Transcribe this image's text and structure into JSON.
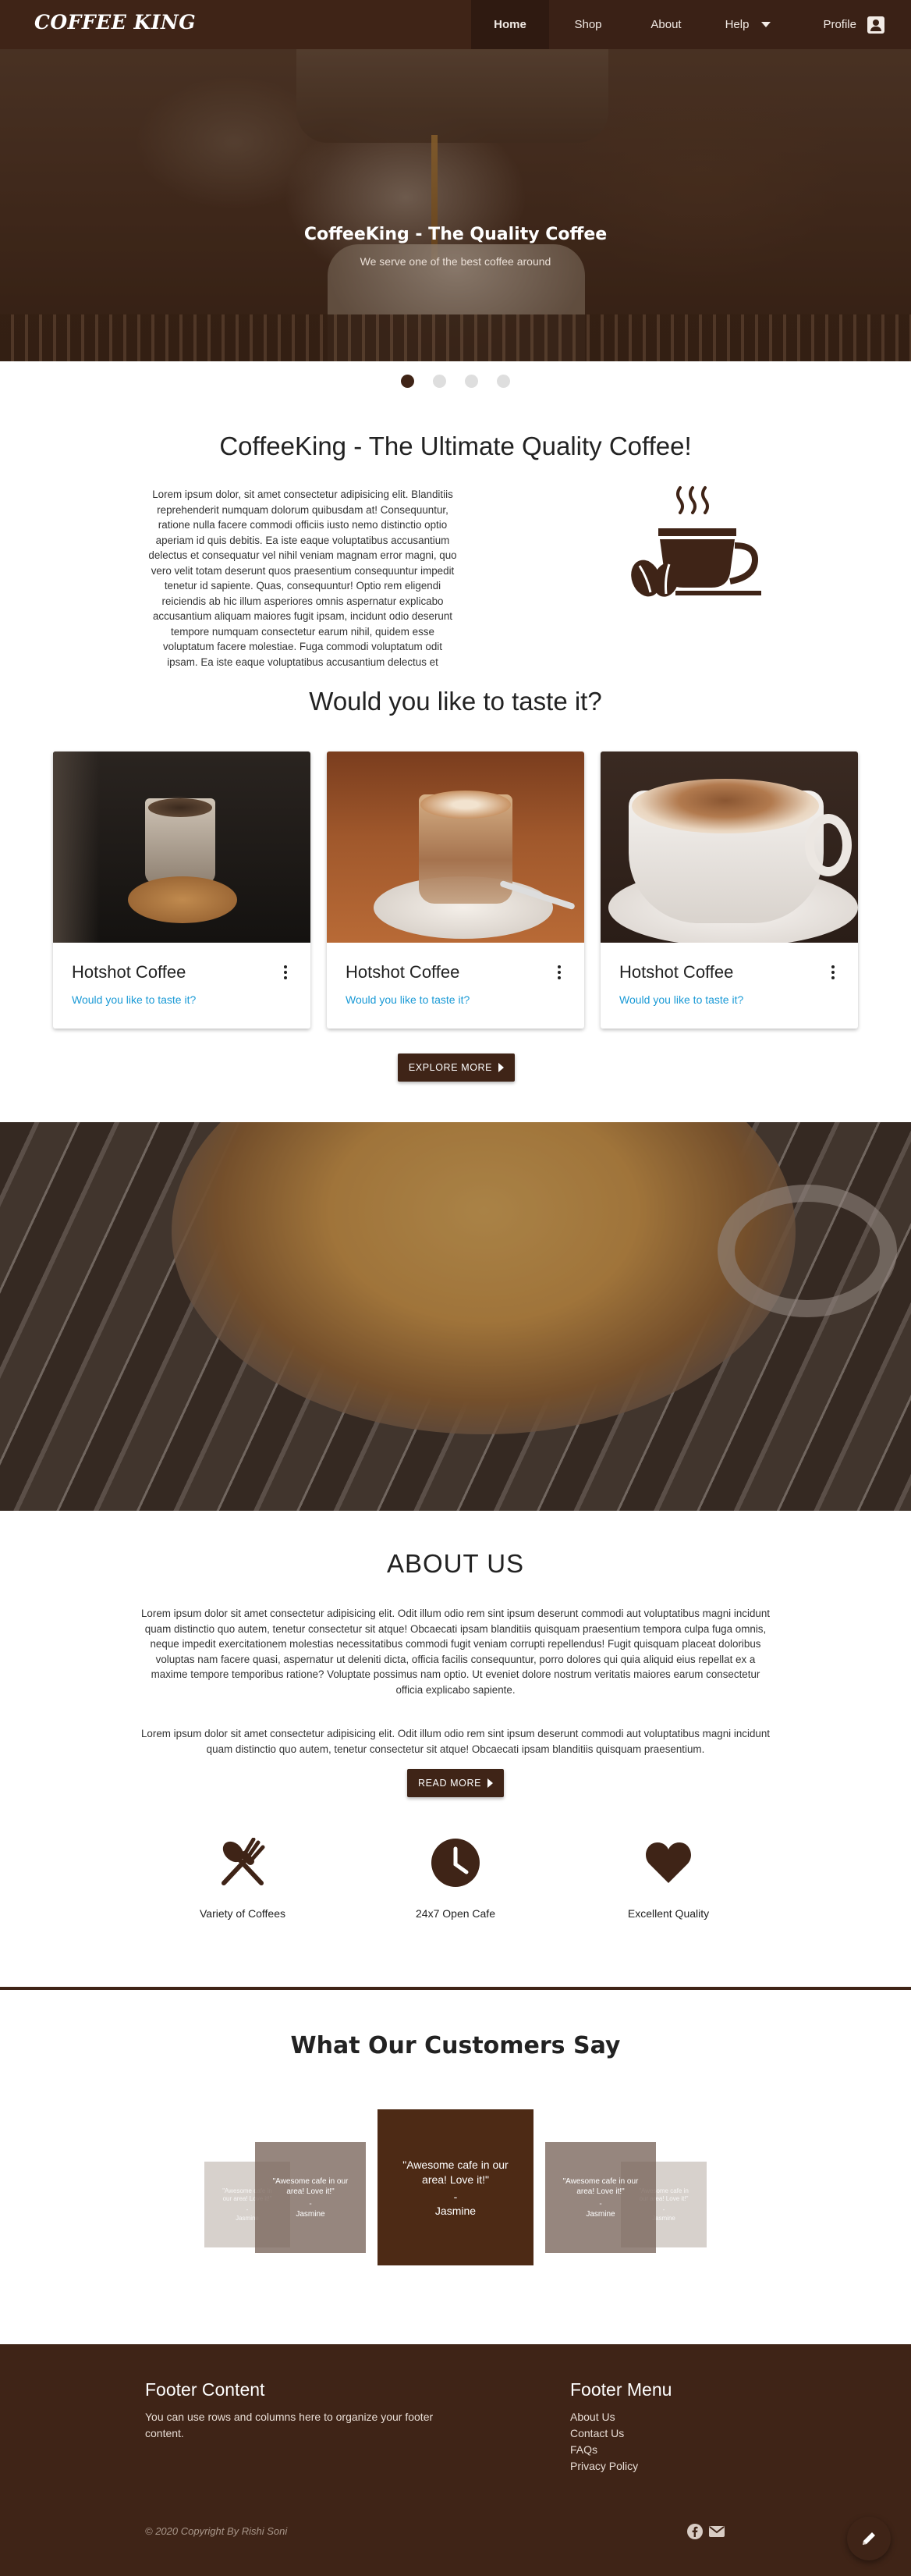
{
  "brand": "COFFEE KING",
  "nav": {
    "items": [
      "Home",
      "Shop",
      "About",
      "Help"
    ],
    "profile": "Profile"
  },
  "hero": {
    "title": "CoffeeKing - The Quality Coffee",
    "subtitle": "We serve one of the best coffee around"
  },
  "carousel": {
    "slides": 4,
    "active": 1
  },
  "intro": {
    "title": "CoffeeKing - The Ultimate Quality Coffee!",
    "text": "Lorem ipsum dolor, sit amet consectetur adipisicing elit. Blanditiis reprehenderit numquam dolorum quibusdam at! Consequuntur, ratione nulla facere commodi officiis iusto nemo distinctio optio aperiam id quis debitis. Ea iste eaque voluptatibus accusantium delectus et consequatur vel nihil veniam magnam error magni, quo vero velit totam deserunt quos praesentium consequuntur impedit tenetur id sapiente. Quas, consequuntur! Optio rem eligendi reiciendis ab hic illum asperiores omnis aspernatur explicabo accusantium aliquam maiores fugit ipsam, incidunt odio deserunt tempore numquam consectetur earum nihil, quidem esse voluptatum facere molestiae. Fuga commodi voluptatum odit ipsam. Ea iste eaque voluptatibus accusantium delectus et"
  },
  "taste": {
    "title": "Would you like to taste it?",
    "cards": [
      {
        "title": "Hotshot Coffee",
        "link": "Would you like to taste it?"
      },
      {
        "title": "Hotshot Coffee",
        "link": "Would you like to taste it?"
      },
      {
        "title": "Hotshot Coffee",
        "link": "Would you like to taste it?"
      }
    ],
    "button": "EXPLORE MORE"
  },
  "about": {
    "title": "ABOUT US",
    "p1": "Lorem ipsum dolor sit amet consectetur adipisicing elit. Odit illum odio rem sint ipsum deserunt commodi aut voluptatibus magni incidunt quam distinctio quo autem, tenetur consectetur sit atque! Obcaecati ipsam blanditiis quisquam praesentium tempora culpa fuga omnis, neque impedit exercitationem molestias necessitatibus commodi fugit veniam corrupti repellendus! Fugit quisquam placeat doloribus voluptas nam facere quasi, aspernatur ut deleniti dicta, officia facilis consequuntur, porro dolores qui quia aliquid eius repellat ex a maxime tempore temporibus ratione? Voluptate possimus nam optio. Ut eveniet dolore nostrum veritatis maiores earum consectetur officia explicabo sapiente.",
    "p2": "Lorem ipsum dolor sit amet consectetur adipisicing elit. Odit illum odio rem sint ipsum deserunt commodi aut voluptatibus magni incidunt quam distinctio quo autem, tenetur consectetur sit atque! Obcaecati ipsam blanditiis quisquam praesentium.",
    "button": "READ MORE",
    "features": [
      {
        "label": "Variety of Coffees",
        "icon": "spoon-fork-icon"
      },
      {
        "label": "24x7 Open Cafe",
        "icon": "clock-icon"
      },
      {
        "label": "Excellent Quality",
        "icon": "heart-icon"
      }
    ]
  },
  "testimonials": {
    "title": "What Our Customers Say",
    "quote": "\"Awesome cafe in our area! Love it!\"",
    "dash": "-",
    "name": "Jasmine"
  },
  "footer": {
    "content_title": "Footer Content",
    "content_text": "You can use rows and columns here to organize your footer content.",
    "menu_title": "Footer Menu",
    "menu": [
      "About Us",
      "Contact Us",
      "FAQs",
      "Privacy Policy"
    ],
    "copyright": "© 2020 Copyright By Rishi Soni"
  },
  "colors": {
    "brand_brown": "#3f2417",
    "link_blue": "#1a9ad6"
  }
}
